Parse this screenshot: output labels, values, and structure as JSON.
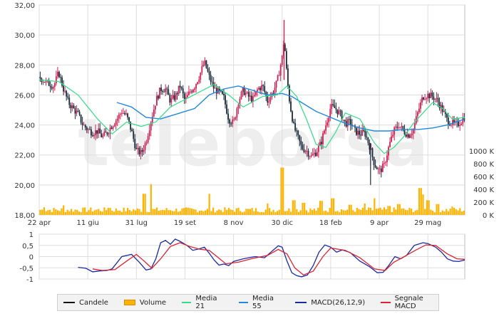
{
  "colors": {
    "up_candle": "#cc2255",
    "down_candle": "#1a2a3a",
    "volume": "#ffb300",
    "ma21": "#33dd88",
    "ma55": "#2288dd",
    "macd": "#1a2aa0",
    "signal": "#dd2233",
    "grid": "#dddddd",
    "watermark": "#eeeeee"
  },
  "watermark": "teleborsa",
  "legend": [
    {
      "label": "Candele",
      "color": "#111111",
      "kind": "line"
    },
    {
      "label": "Volume",
      "color": "#ffb300",
      "kind": "box"
    },
    {
      "label": "Media 21",
      "color": "#33dd88",
      "kind": "line"
    },
    {
      "label": "Media 55",
      "color": "#2288dd",
      "kind": "line"
    },
    {
      "label": "MACD(26,12,9)",
      "color": "#1a2aa0",
      "kind": "line"
    },
    {
      "label": "Segnale MACD",
      "color": "#dd2233",
      "kind": "line"
    }
  ],
  "chart_data": [
    {
      "type": "candlestick",
      "x_ticks": [
        "22 apr",
        "11 giu",
        "31 lug",
        "19 set",
        "8 nov",
        "30 dic",
        "18 feb",
        "9 apr",
        "29 mag"
      ],
      "x_tick_days": [
        0,
        50,
        100,
        150,
        200,
        250,
        300,
        350,
        400
      ],
      "y_ticks": [
        "18,00",
        "20,00",
        "22,00",
        "24,00",
        "26,00",
        "28,00",
        "30,00",
        "32,00"
      ],
      "ylim": [
        18,
        32
      ],
      "volume_ticks": [
        "0 K",
        "200 K",
        "400 K",
        "600 K",
        "800 K",
        "1000 K"
      ],
      "volume_lim": [
        0,
        1000000
      ],
      "grid": true,
      "close_points": [
        [
          0,
          27.2
        ],
        [
          8,
          26.8
        ],
        [
          15,
          26.6
        ],
        [
          20,
          27.5
        ],
        [
          25,
          26.4
        ],
        [
          30,
          25.5
        ],
        [
          35,
          25.1
        ],
        [
          40,
          24.7
        ],
        [
          45,
          24.0
        ],
        [
          50,
          23.7
        ],
        [
          55,
          23.5
        ],
        [
          60,
          23.6
        ],
        [
          65,
          23.2
        ],
        [
          70,
          23.5
        ],
        [
          75,
          24.0
        ],
        [
          80,
          24.4
        ],
        [
          85,
          24.9
        ],
        [
          90,
          24.6
        ],
        [
          95,
          23.6
        ],
        [
          100,
          22.3
        ],
        [
          105,
          22.1
        ],
        [
          110,
          22.9
        ],
        [
          115,
          24.3
        ],
        [
          120,
          25.6
        ],
        [
          125,
          26.4
        ],
        [
          130,
          26.4
        ],
        [
          135,
          25.6
        ],
        [
          140,
          25.9
        ],
        [
          145,
          26.6
        ],
        [
          150,
          25.6
        ],
        [
          155,
          26.2
        ],
        [
          160,
          26.6
        ],
        [
          165,
          27.3
        ],
        [
          170,
          28.2
        ],
        [
          175,
          27.2
        ],
        [
          180,
          26.4
        ],
        [
          185,
          26.2
        ],
        [
          190,
          25.8
        ],
        [
          195,
          24.4
        ],
        [
          200,
          24.1
        ],
        [
          205,
          25.6
        ],
        [
          210,
          26.3
        ],
        [
          215,
          25.9
        ],
        [
          220,
          25.7
        ],
        [
          225,
          26.4
        ],
        [
          230,
          26.6
        ],
        [
          235,
          25.6
        ],
        [
          240,
          26.1
        ],
        [
          245,
          26.9
        ],
        [
          250,
          28.5
        ],
        [
          252,
          29.8
        ],
        [
          255,
          27.2
        ],
        [
          258,
          25.4
        ],
        [
          262,
          23.9
        ],
        [
          266,
          23.2
        ],
        [
          270,
          22.5
        ],
        [
          275,
          22.3
        ],
        [
          280,
          21.9
        ],
        [
          285,
          22.2
        ],
        [
          290,
          22.8
        ],
        [
          295,
          24.0
        ],
        [
          300,
          25.2
        ],
        [
          305,
          25.1
        ],
        [
          310,
          24.7
        ],
        [
          315,
          24.1
        ],
        [
          320,
          24.2
        ],
        [
          325,
          23.6
        ],
        [
          330,
          23.4
        ],
        [
          335,
          23.5
        ],
        [
          340,
          22.6
        ],
        [
          345,
          21.4
        ],
        [
          350,
          20.9
        ],
        [
          355,
          21.3
        ],
        [
          360,
          22.6
        ],
        [
          365,
          23.6
        ],
        [
          370,
          24.0
        ],
        [
          375,
          23.6
        ],
        [
          380,
          23.3
        ],
        [
          385,
          23.7
        ],
        [
          390,
          24.9
        ],
        [
          395,
          25.9
        ],
        [
          400,
          26.0
        ],
        [
          405,
          25.9
        ],
        [
          410,
          25.6
        ],
        [
          415,
          25.0
        ],
        [
          420,
          24.3
        ],
        [
          425,
          24.1
        ],
        [
          430,
          24.0
        ],
        [
          435,
          24.3
        ],
        [
          438,
          24.6
        ]
      ],
      "ma21_points": [
        [
          0,
          27.0
        ],
        [
          20,
          26.9
        ],
        [
          40,
          26.0
        ],
        [
          60,
          24.4
        ],
        [
          75,
          23.4
        ],
        [
          90,
          24.2
        ],
        [
          105,
          23.9
        ],
        [
          120,
          24.2
        ],
        [
          135,
          25.2
        ],
        [
          150,
          25.7
        ],
        [
          165,
          26.2
        ],
        [
          180,
          26.7
        ],
        [
          195,
          26.0
        ],
        [
          210,
          25.2
        ],
        [
          230,
          25.9
        ],
        [
          245,
          26.0
        ],
        [
          255,
          26.6
        ],
        [
          265,
          25.9
        ],
        [
          275,
          24.4
        ],
        [
          285,
          22.7
        ],
        [
          295,
          22.5
        ],
        [
          305,
          23.5
        ],
        [
          315,
          24.8
        ],
        [
          330,
          24.4
        ],
        [
          345,
          22.8
        ],
        [
          355,
          22.1
        ],
        [
          365,
          22.5
        ],
        [
          375,
          23.2
        ],
        [
          385,
          24.1
        ],
        [
          395,
          24.8
        ],
        [
          405,
          25.5
        ],
        [
          415,
          25.1
        ],
        [
          425,
          24.4
        ],
        [
          438,
          24.5
        ]
      ],
      "ma55_points": [
        [
          80,
          25.5
        ],
        [
          95,
          25.2
        ],
        [
          110,
          24.5
        ],
        [
          125,
          24.4
        ],
        [
          140,
          24.7
        ],
        [
          160,
          25.1
        ],
        [
          175,
          26.0
        ],
        [
          190,
          26.4
        ],
        [
          205,
          26.6
        ],
        [
          220,
          26.3
        ],
        [
          235,
          26.0
        ],
        [
          250,
          26.1
        ],
        [
          260,
          25.9
        ],
        [
          270,
          25.5
        ],
        [
          285,
          24.9
        ],
        [
          300,
          24.5
        ],
        [
          315,
          24.1
        ],
        [
          330,
          23.8
        ],
        [
          345,
          23.6
        ],
        [
          360,
          23.6
        ],
        [
          375,
          23.7
        ],
        [
          390,
          23.7
        ],
        [
          405,
          23.8
        ],
        [
          420,
          24.0
        ],
        [
          438,
          24.4
        ]
      ],
      "volume_spikes": [
        [
          5,
          120000
        ],
        [
          25,
          150000
        ],
        [
          72,
          110000
        ],
        [
          108,
          330000
        ],
        [
          115,
          480000
        ],
        [
          175,
          330000
        ],
        [
          235,
          180000
        ],
        [
          250,
          740000
        ],
        [
          262,
          230000
        ],
        [
          272,
          190000
        ],
        [
          290,
          220000
        ],
        [
          302,
          260000
        ],
        [
          320,
          160000
        ],
        [
          335,
          180000
        ],
        [
          345,
          260000
        ],
        [
          360,
          140000
        ],
        [
          370,
          170000
        ],
        [
          392,
          420000
        ],
        [
          395,
          320000
        ],
        [
          400,
          230000
        ],
        [
          410,
          170000
        ],
        [
          425,
          130000
        ]
      ]
    },
    {
      "type": "line",
      "y_ticks": [
        "1",
        "0,5",
        "0",
        "-0,5",
        "-1"
      ],
      "ylim": [
        -1,
        1
      ],
      "series": [
        {
          "name": "MACD(26,12,9)",
          "points": [
            [
              40,
              -0.48
            ],
            [
              48,
              -0.52
            ],
            [
              55,
              -0.68
            ],
            [
              62,
              -0.64
            ],
            [
              70,
              -0.62
            ],
            [
              75,
              -0.55
            ],
            [
              85,
              0.0
            ],
            [
              95,
              0.1
            ],
            [
              103,
              -0.25
            ],
            [
              110,
              -0.6
            ],
            [
              115,
              -0.55
            ],
            [
              120,
              -0.1
            ],
            [
              125,
              0.62
            ],
            [
              130,
              0.72
            ],
            [
              135,
              0.55
            ],
            [
              140,
              0.78
            ],
            [
              145,
              0.68
            ],
            [
              152,
              0.5
            ],
            [
              158,
              0.28
            ],
            [
              165,
              0.35
            ],
            [
              170,
              0.42
            ],
            [
              175,
              0.15
            ],
            [
              180,
              -0.15
            ],
            [
              185,
              -0.38
            ],
            [
              190,
              -0.33
            ],
            [
              195,
              -0.4
            ],
            [
              200,
              -0.22
            ],
            [
              210,
              -0.1
            ],
            [
              222,
              0.0
            ],
            [
              232,
              -0.05
            ],
            [
              238,
              0.18
            ],
            [
              246,
              0.48
            ],
            [
              250,
              0.42
            ],
            [
              255,
              -0.2
            ],
            [
              260,
              -0.72
            ],
            [
              265,
              -0.85
            ],
            [
              270,
              -0.9
            ],
            [
              276,
              -0.82
            ],
            [
              282,
              -0.4
            ],
            [
              288,
              0.2
            ],
            [
              294,
              0.52
            ],
            [
              300,
              0.42
            ],
            [
              306,
              0.2
            ],
            [
              312,
              0.3
            ],
            [
              320,
              0.18
            ],
            [
              330,
              -0.2
            ],
            [
              340,
              -0.45
            ],
            [
              348,
              -0.72
            ],
            [
              354,
              -0.7
            ],
            [
              360,
              -0.38
            ],
            [
              366,
              0.0
            ],
            [
              372,
              -0.1
            ],
            [
              378,
              0.05
            ],
            [
              386,
              0.5
            ],
            [
              395,
              0.62
            ],
            [
              400,
              0.58
            ],
            [
              408,
              0.42
            ],
            [
              414,
              0.2
            ],
            [
              420,
              -0.1
            ],
            [
              426,
              -0.2
            ],
            [
              432,
              -0.22
            ],
            [
              438,
              -0.15
            ]
          ]
        },
        {
          "name": "Segnale MACD",
          "points": [
            [
              55,
              -0.55
            ],
            [
              65,
              -0.62
            ],
            [
              78,
              -0.58
            ],
            [
              90,
              -0.2
            ],
            [
              100,
              0.1
            ],
            [
              108,
              -0.2
            ],
            [
              116,
              -0.52
            ],
            [
              125,
              -0.1
            ],
            [
              135,
              0.45
            ],
            [
              145,
              0.62
            ],
            [
              155,
              0.45
            ],
            [
              165,
              0.33
            ],
            [
              175,
              0.28
            ],
            [
              183,
              0.0
            ],
            [
              192,
              -0.32
            ],
            [
              205,
              -0.25
            ],
            [
              220,
              -0.08
            ],
            [
              235,
              0.05
            ],
            [
              246,
              0.32
            ],
            [
              255,
              0.12
            ],
            [
              263,
              -0.5
            ],
            [
              272,
              -0.82
            ],
            [
              282,
              -0.65
            ],
            [
              292,
              0.0
            ],
            [
              300,
              0.38
            ],
            [
              315,
              0.28
            ],
            [
              330,
              -0.05
            ],
            [
              345,
              -0.55
            ],
            [
              356,
              -0.62
            ],
            [
              365,
              -0.25
            ],
            [
              375,
              -0.02
            ],
            [
              388,
              0.3
            ],
            [
              398,
              0.52
            ],
            [
              408,
              0.5
            ],
            [
              420,
              0.12
            ],
            [
              430,
              -0.1
            ],
            [
              438,
              -0.12
            ]
          ]
        }
      ]
    }
  ]
}
